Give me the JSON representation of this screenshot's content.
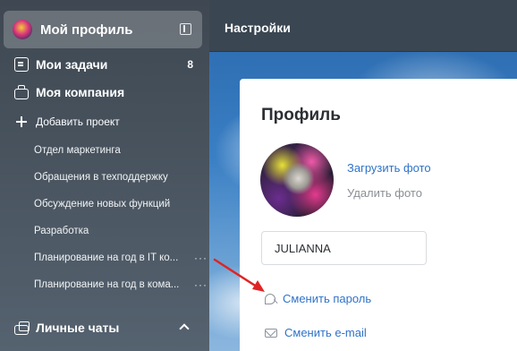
{
  "sidebar": {
    "profile_label": "Мой профиль",
    "items": [
      {
        "label": "Мои задачи",
        "icon": "tasks-icon",
        "count": "8"
      },
      {
        "label": "Моя компания",
        "icon": "briefcase-icon"
      },
      {
        "label": "Добавить проект",
        "icon": "plus-icon"
      }
    ],
    "projects": [
      "Отдел маркетинга",
      "Обращения в техподдержку",
      "Обсуждение новых функций",
      "Разработка",
      "Планирование на год в IT ко...",
      "Планирование на год в кома..."
    ],
    "more_dots": "···",
    "chats_label": "Личные чаты"
  },
  "header": {
    "title": "Настройки"
  },
  "profile": {
    "title": "Профиль",
    "upload_photo": "Загрузить фото",
    "delete_photo": "Удалить фото",
    "name_value": "JULIANNA",
    "change_password": "Сменить пароль",
    "change_email": "Сменить e-mail"
  },
  "colors": {
    "link": "#2f73c9",
    "annotation_arrow": "#e02424"
  }
}
